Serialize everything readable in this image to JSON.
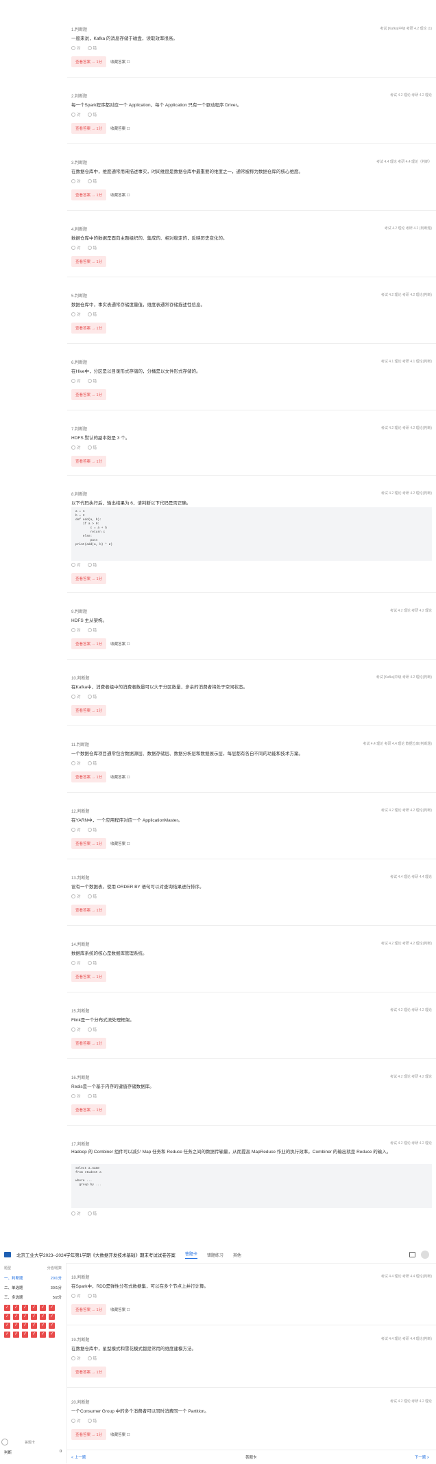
{
  "questions_top": [
    {
      "type": "1.判断题",
      "tags": "考试  [Kafka]中级    考研 4.2 理论 (1)",
      "text": "一般来说，Kafka 的消息存储于磁盘，读取效率很高。",
      "opt_a": "对",
      "opt_b": "错",
      "answer_label": "查看答案 → 1分",
      "fav_label": "收藏答案 ☐"
    },
    {
      "type": "2.判断题",
      "tags": "考试 4.2 理论    考研 4.2 理论",
      "text": "每一个Spark程序都对应一个 Application，每个 Application 只有一个驱动程序 Driver。",
      "opt_a": "对",
      "opt_b": "错",
      "answer_label": "查看答案 → 1分",
      "fav_label": "收藏答案 ☐"
    },
    {
      "type": "3.判断题",
      "tags": "考试 4.4 理论    考研 4.4 理论（判断）",
      "text": "在数据仓库中，维度通常用来描述事实，时间维度是数据仓库中最重要的维度之一，通常被称为数据仓库的核心维度。",
      "opt_a": "对",
      "opt_b": "错",
      "answer_label": "查看答案 → 1分",
      "fav_label": "收藏答案 ☐"
    },
    {
      "type": "4.判断题",
      "tags": "考试 4.2 理论    考研 4.2 (判断题)",
      "text": "数据仓库中的数据是面向主题组织的、集成的、相对稳定的，反映历史变化的。",
      "opt_a": "对",
      "opt_b": "错",
      "answer_label": "查看答案 → 1分"
    },
    {
      "type": "5.判断题",
      "tags": "考试 4.2 理论    考研 4.2 理论(判断)",
      "text": "数据仓库中，事实表通常存储度量值，维度表通常存储描述性信息。",
      "opt_a": "对",
      "opt_b": "错",
      "answer_label": "查看答案 → 1分"
    },
    {
      "type": "6.判断题",
      "tags": "考试 4.1 理论    考研 4.1 理论(判断)",
      "text": "在Hive中，分区是以目录形式存储的，分桶是以文件形式存储的。",
      "opt_a": "对",
      "opt_b": "错",
      "answer_label": "查看答案 → 1分"
    },
    {
      "type": "7.判断题",
      "tags": "考试 4.2 理论    考研 4.2 理论(判断)",
      "text": "HDFS 默认的副本数是 3 个。",
      "opt_a": "对",
      "opt_b": "错",
      "answer_label": "查看答案 → 1分"
    },
    {
      "type": "8.判断题",
      "tags": "考试 4.2 理论    考研 4.2 理论(判断)",
      "text": "以下代码执行后，输出结果为 6，请判断以下代码是否正确。",
      "code": "a = 1\nb = 2\ndef add(a, b):\n    if a > 0:\n        c = a + b\n        return c\n    else:\n        pass\nprint(add(a, b) * 2)",
      "opt_a": "对",
      "opt_b": "错",
      "answer_label": "查看答案 → 1分"
    },
    {
      "type": "9.判断题",
      "tags": "考试 4.2 理论    考研 4.2 理论",
      "text": "HDFS 主从架构。",
      "opt_a": "对",
      "opt_b": "错",
      "answer_label": "查看答案 → 1分",
      "fav_label": "收藏答案 ☐"
    },
    {
      "type": "10.判断题",
      "tags": "考试 [Kafka]中级    考研 4.2 理论(判断)",
      "text": "在Kafka中，消费者组中的消费者数量可以大于分区数量，多余的消费者将处于空闲状态。",
      "opt_a": "对",
      "opt_b": "错",
      "answer_label": "查看答案 → 1分"
    },
    {
      "type": "11.判断题",
      "tags": "考试 4.4 理论    考研 4.4 理论 数据仓库(判断题)",
      "text": "一个数据仓库项目通常包含数据源层、数据存储层、数据分析层和数据展示层，每层都有各自不同的功能和技术方案。",
      "opt_a": "对",
      "opt_b": "错",
      "answer_label": "查看答案 → 1分",
      "fav_label": "收藏答案 ☐"
    },
    {
      "type": "12.判断题",
      "tags": "考试 4.2 理论    考研 4.2 理论(判断)",
      "text": "在YARN中，一个应用程序对应一个 ApplicationMaster。",
      "opt_a": "对",
      "opt_b": "错",
      "answer_label": "查看答案 → 1分",
      "fav_label": "收藏答案 ☐"
    },
    {
      "type": "13.判断题",
      "tags": "考试 4.4 理论    考研 4.4 理论",
      "text": "设有一个数据表，使用 ORDER BY 语句可以对查询结果进行排序。",
      "opt_a": "对",
      "opt_b": "错",
      "answer_label": "查看答案 → 1分"
    },
    {
      "type": "14.判断题",
      "tags": "考试 4.2 理论    考研 4.2 理论(判断)",
      "text": "数据库系统的核心是数据库管理系统。",
      "opt_a": "对",
      "opt_b": "错",
      "answer_label": "查看答案 → 1分"
    },
    {
      "type": "15.判断题",
      "tags": "考试 4.2 理论    考研 4.2 理论",
      "text": "Flink是一个分布式流处理框架。",
      "opt_a": "对",
      "opt_b": "错",
      "answer_label": "查看答案 → 1分"
    },
    {
      "type": "16.判断题",
      "tags": "考试 4.2 理论    考研 4.2 理论",
      "text": "Redis是一个基于内存的键值存储数据库。",
      "opt_a": "对",
      "opt_b": "错",
      "answer_label": "查看答案 → 1分"
    },
    {
      "type": "17.判断题",
      "tags": "考试 4.2 理论    考研 4.2 理论",
      "text": "Hadoop 的 Combiner 组件可以减少 Map 任务和 Reduce 任务之间的数据传输量，从而提高 MapReduce 作业的执行效率。Combiner 的输出就是 Reduce 的输入。",
      "code": "select a.name\nfrom student a\n\nwhere ...\n  group by ...",
      "opt_a": "对",
      "opt_b": "错"
    }
  ],
  "header": {
    "title": "北京工业大学2023--2024学年第1学期《大数据开发技术基础》期末考试试卷答案",
    "tabs": [
      "答题卡",
      "错题练习",
      "其他"
    ]
  },
  "sidebar": {
    "col1": "题型",
    "col2": "分值/题数",
    "rows": [
      {
        "label": "一、判断题",
        "value": "20/1分"
      },
      {
        "label": "二、单选题",
        "value": "30/1分"
      },
      {
        "label": "三、多选题",
        "value": "5/2分"
      }
    ],
    "grid_marks": [
      "✓",
      "✓",
      "✓",
      "✓",
      "✓",
      "✓",
      "✓",
      "✓",
      "✓",
      "✓",
      "✓",
      "✓",
      "✓",
      "✓",
      "✓",
      "✓",
      "✓",
      "✓",
      "✓",
      "✓",
      "✓",
      "✓",
      "✓",
      "✓"
    ],
    "foot_hint": "答题卡",
    "foot_left": "判断",
    "foot_right": "0"
  },
  "questions_bottom": [
    {
      "type": "18.判断题",
      "tags": "考试 4.4 理论    考研 4.4 理论(判断)",
      "text": "在Spark中，RDD是弹性分布式数据集，可以在多个节点上并行计算。",
      "opt_a": "对",
      "opt_b": "错",
      "answer_label": "查看答案 → 1分",
      "fav_label": "收藏答案 ☐"
    },
    {
      "type": "19.判断题",
      "tags": "考试 4.4 理论    考研 4.4 理论(判断)",
      "text": "在数据仓库中，星型模式和雪花模式都是常用的维度建模方法。",
      "opt_a": "对",
      "opt_b": "错",
      "answer_label": "查看答案 → 1分"
    },
    {
      "type": "20.判断题",
      "tags": "考试 4.2 理论    考研 4.2 理论",
      "text": "一个Consumer Group 中的多个消费者可以同时消费同一个 Partition。",
      "opt_a": "对",
      "opt_b": "错",
      "answer_label": "查看答案 → 1分",
      "fav_label": "收藏答案 ☐"
    }
  ],
  "bottom_bar": {
    "prev": "< 上一题",
    "sheet": "答题卡",
    "next": "下一题 >"
  },
  "colors": {
    "accent": "#1f6ee0",
    "answer_bg": "#fde8e8",
    "answer_text": "#e55050",
    "grid_mark": "#e84a4a"
  }
}
